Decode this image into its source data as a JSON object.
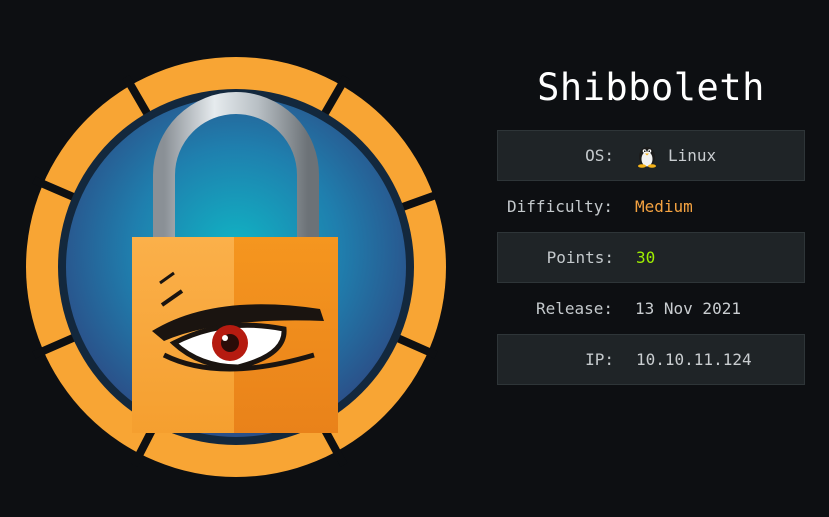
{
  "machine": {
    "name": "Shibboleth"
  },
  "info": {
    "os_label": "OS:",
    "os_value": "Linux",
    "os_icon": "linux-tux-icon",
    "difficulty_label": "Difficulty:",
    "difficulty_value": "Medium",
    "points_label": "Points:",
    "points_value": "30",
    "release_label": "Release:",
    "release_value": "13 Nov 2021",
    "ip_label": "IP:",
    "ip_value": "10.10.11.124"
  },
  "colors": {
    "background": "#0d0f12",
    "ring_orange": "#f8a534",
    "medium": "#f5a341",
    "points": "#9fef00",
    "row_shade": "#1f2427"
  }
}
